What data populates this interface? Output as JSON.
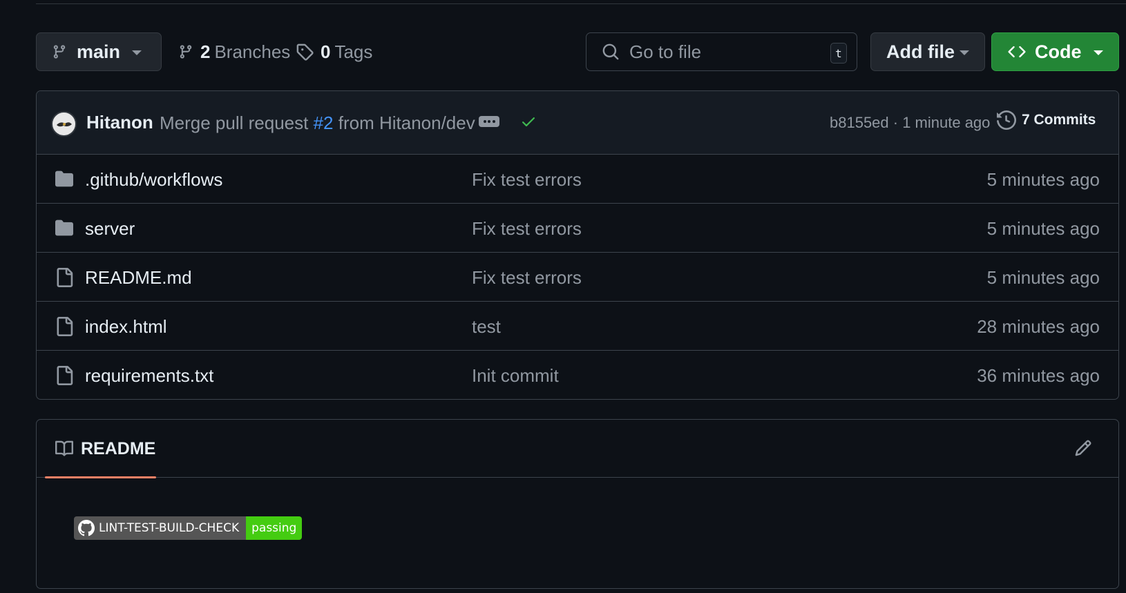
{
  "toolbar": {
    "branch": "main",
    "branches_count": "2",
    "branches_label": "Branches",
    "tags_count": "0",
    "tags_label": "Tags",
    "search_placeholder": "Go to file",
    "search_shortcut": "t",
    "add_file_label": "Add file",
    "code_label": "Code"
  },
  "commit": {
    "author": "Hitanon",
    "message_prefix": "Merge pull request",
    "pr_number": "#2",
    "message_suffix": "from Hitanon/dev",
    "hash_time": "b8155ed · 1 minute ago",
    "commits_label": "7 Commits",
    "status": "success"
  },
  "files": [
    {
      "name": ".github/workflows",
      "type": "folder",
      "message": "Fix test errors",
      "age": "5 minutes ago"
    },
    {
      "name": "server",
      "type": "folder",
      "message": "Fix test errors",
      "age": "5 minutes ago"
    },
    {
      "name": "README.md",
      "type": "file",
      "message": "Fix test errors",
      "age": "5 minutes ago"
    },
    {
      "name": "index.html",
      "type": "file",
      "message": "test",
      "age": "28 minutes ago"
    },
    {
      "name": "requirements.txt",
      "type": "file",
      "message": "Init commit",
      "age": "36 minutes ago"
    }
  ],
  "readme": {
    "tab_label": "README",
    "badge_label": "LINT-TEST-BUILD-CHECK",
    "badge_status": "passing"
  },
  "colors": {
    "background": "#0d1117",
    "accent_green": "#238636",
    "link_blue": "#4493f8",
    "tab_underline": "#f78166",
    "badge_green": "#44cc11"
  }
}
